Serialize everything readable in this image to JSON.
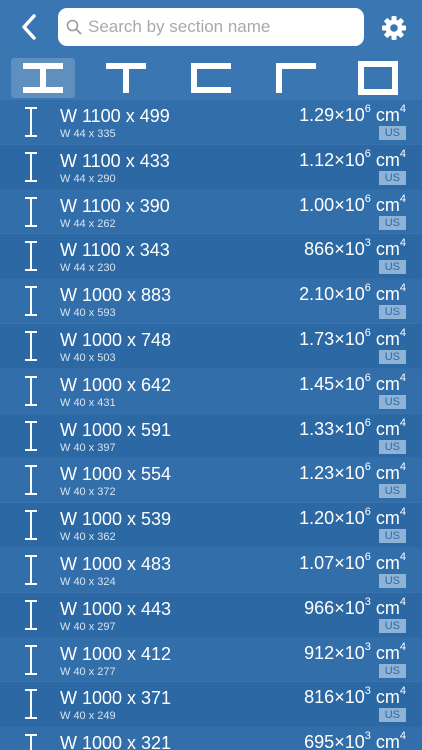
{
  "search": {
    "placeholder": "Search by section name"
  },
  "shapes": [
    "I-section",
    "T-section",
    "channel",
    "angle",
    "hollow-rectangle"
  ],
  "colors": {
    "background": "#2e6aa6",
    "bar": "#3a76b1",
    "badge": "#8fb3d6"
  },
  "rows": [
    {
      "name": "W 1100 x 499",
      "sub": "W 44 x 335",
      "mant": "1.29",
      "exp": "6",
      "unit": "cm",
      "uexp": "4",
      "badge": "US"
    },
    {
      "name": "W 1100 x 433",
      "sub": "W 44 x 290",
      "mant": "1.12",
      "exp": "6",
      "unit": "cm",
      "uexp": "4",
      "badge": "US"
    },
    {
      "name": "W 1100 x 390",
      "sub": "W 44 x 262",
      "mant": "1.00",
      "exp": "6",
      "unit": "cm",
      "uexp": "4",
      "badge": "US"
    },
    {
      "name": "W 1100 x 343",
      "sub": "W 44 x 230",
      "mant": "866",
      "exp": "3",
      "unit": "cm",
      "uexp": "4",
      "badge": "US"
    },
    {
      "name": "W 1000 x 883",
      "sub": "W 40 x 593",
      "mant": "2.10",
      "exp": "6",
      "unit": "cm",
      "uexp": "4",
      "badge": "US"
    },
    {
      "name": "W 1000 x 748",
      "sub": "W 40 x 503",
      "mant": "1.73",
      "exp": "6",
      "unit": "cm",
      "uexp": "4",
      "badge": "US"
    },
    {
      "name": "W 1000 x 642",
      "sub": "W 40 x 431",
      "mant": "1.45",
      "exp": "6",
      "unit": "cm",
      "uexp": "4",
      "badge": "US"
    },
    {
      "name": "W 1000 x 591",
      "sub": "W 40 x 397",
      "mant": "1.33",
      "exp": "6",
      "unit": "cm",
      "uexp": "4",
      "badge": "US"
    },
    {
      "name": "W 1000 x 554",
      "sub": "W 40 x 372",
      "mant": "1.23",
      "exp": "6",
      "unit": "cm",
      "uexp": "4",
      "badge": "US"
    },
    {
      "name": "W 1000 x 539",
      "sub": "W 40 x 362",
      "mant": "1.20",
      "exp": "6",
      "unit": "cm",
      "uexp": "4",
      "badge": "US"
    },
    {
      "name": "W 1000 x 483",
      "sub": "W 40 x 324",
      "mant": "1.07",
      "exp": "6",
      "unit": "cm",
      "uexp": "4",
      "badge": "US"
    },
    {
      "name": "W 1000 x 443",
      "sub": "W 40 x 297",
      "mant": "966",
      "exp": "3",
      "unit": "cm",
      "uexp": "4",
      "badge": "US"
    },
    {
      "name": "W 1000 x 412",
      "sub": "W 40 x 277",
      "mant": "912",
      "exp": "3",
      "unit": "cm",
      "uexp": "4",
      "badge": "US"
    },
    {
      "name": "W 1000 x 371",
      "sub": "W 40 x 249",
      "mant": "816",
      "exp": "3",
      "unit": "cm",
      "uexp": "4",
      "badge": "US"
    },
    {
      "name": "W 1000 x 321",
      "sub": "",
      "mant": "695",
      "exp": "3",
      "unit": "cm",
      "uexp": "4",
      "badge": ""
    }
  ]
}
